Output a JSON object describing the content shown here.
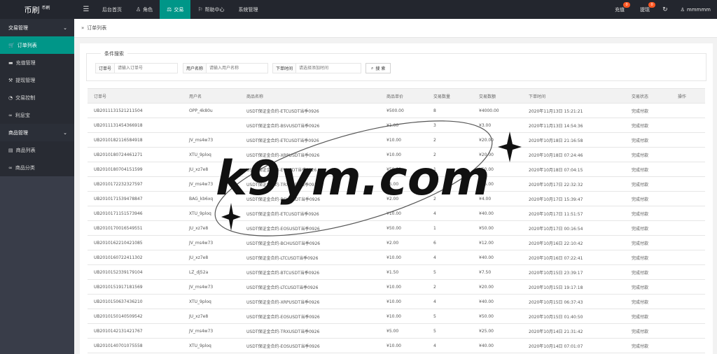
{
  "app": {
    "logo": "币刷",
    "logo_sub": "币刷"
  },
  "topnav": {
    "menu_icon": "hamburger-icon",
    "items": [
      {
        "label": "后台首页",
        "icon": ""
      },
      {
        "label": "角色",
        "icon": "user-icon"
      },
      {
        "label": "交易",
        "icon": "exchange-icon",
        "active": true
      },
      {
        "label": "帮助中心",
        "icon": "flag-icon"
      },
      {
        "label": "系统管理",
        "icon": ""
      }
    ],
    "recharge": "充值",
    "recharge_badge": "0",
    "withdraw": "提现",
    "withdraw_badge": "0",
    "username": "mmmmm"
  },
  "sidebar": {
    "groups": [
      {
        "title": "交易管理",
        "items": [
          "订单列表",
          "充值管理",
          "提现管理",
          "交易控制",
          "利息宝"
        ]
      },
      {
        "title": "商品管理",
        "items": [
          "商品列表",
          "商品分类"
        ]
      }
    ]
  },
  "breadcrumb": "订单列表",
  "search": {
    "legend": "条件搜索",
    "order_label": "订单号",
    "order_placeholder": "请输入订单号",
    "user_label": "用户名称",
    "user_placeholder": "请输入用户名称",
    "time_label": "下单时间",
    "time_placeholder": "请选择添加时间",
    "button": "搜 索"
  },
  "table": {
    "headers": [
      "订单号",
      "用户名",
      "商品名称",
      "商品单价",
      "交易数量",
      "交易数额",
      "下单时间",
      "交易状态",
      "操作"
    ],
    "rows": [
      [
        "UB2011131521211504",
        "OPP_4k80u",
        "USDT保证金合约-ETCUSDT当季0926",
        "¥500.00",
        "8",
        "¥4000.00",
        "2020年11月13日 15:21:21",
        "完成付款",
        ""
      ],
      [
        "UB2011131454366918",
        "",
        "USDT保证金合约-BSVUSDT当季0926",
        "¥1.00",
        "3",
        "¥3.00",
        "2020年11月13日 14:54:36",
        "完成付款",
        ""
      ],
      [
        "UB2010182116584918",
        "JV_ms4w73",
        "USDT保证金合约-ETCUSDT当季0926",
        "¥10.00",
        "2",
        "¥20.00",
        "2020年10月18日 21:16:58",
        "完成付款",
        ""
      ],
      [
        "UB2010180724461271",
        "XTU_9ploq",
        "USDT保证金合约-XRPUSDT当季0926",
        "¥10.00",
        "2",
        "¥20.00",
        "2020年10月18日 07:24:46",
        "完成付款",
        ""
      ],
      [
        "UB2010180704151599",
        "JU_xz7e8",
        "USDT保证金合约-EVUSDT当季0926",
        "¥50.00",
        "1",
        "¥50.00",
        "2020年10月18日 07:04:15",
        "完成付款",
        ""
      ],
      [
        "UB2010172232327597",
        "JV_ms4w73",
        "USDT保证金合约-TRXUSDT当季0926",
        "¥5.00",
        "5",
        "¥25.00",
        "2020年10月17日 22:32:32",
        "完成付款",
        ""
      ],
      [
        "UB2010171539478847",
        "BAG_kb6xq",
        "USDT保证金合约-BCHUSDT当季0926",
        "¥2.00",
        "2",
        "¥4.00",
        "2020年10月17日 15:39:47",
        "完成付款",
        ""
      ],
      [
        "UB2010171151573946",
        "XTU_9ploq",
        "USDT保证金合约-ETCUSDT当季0926",
        "¥10.00",
        "4",
        "¥40.00",
        "2020年10月17日 11:51:57",
        "完成付款",
        ""
      ],
      [
        "UB2010170016549551",
        "JU_xz7e8",
        "USDT保证金合约-EOSUSDT当季0926",
        "¥50.00",
        "1",
        "¥50.00",
        "2020年10月17日 00:16:54",
        "完成付款",
        ""
      ],
      [
        "UB2010162210421085",
        "JV_ms4w73",
        "USDT保证金合约-BCHUSDT当季0926",
        "¥2.00",
        "6",
        "¥12.00",
        "2020年10月16日 22:10:42",
        "完成付款",
        ""
      ],
      [
        "UB2010160722411302",
        "JU_xz7e8",
        "USDT保证金合约-LTCUSDT当季0926",
        "¥10.00",
        "4",
        "¥40.00",
        "2020年10月16日 07:22:41",
        "完成付款",
        ""
      ],
      [
        "UB2010152339179104",
        "LZ_dj52a",
        "USDT保证金合约-BTCUSDT当季0926",
        "¥1.50",
        "5",
        "¥7.50",
        "2020年10月15日 23:39:17",
        "完成付款",
        ""
      ],
      [
        "UB2010151917181569",
        "JV_ms4w73",
        "USDT保证金合约-LTCUSDT当季0926",
        "¥10.00",
        "2",
        "¥20.00",
        "2020年10月15日 19:17:18",
        "完成付款",
        ""
      ],
      [
        "UB2010150637436210",
        "XTU_9ploq",
        "USDT保证金合约-XRPUSDT当季0926",
        "¥10.00",
        "4",
        "¥40.00",
        "2020年10月15日 06:37:43",
        "完成付款",
        ""
      ],
      [
        "UB2010150140509542",
        "JU_xz7e8",
        "USDT保证金合约-EOSUSDT当季0926",
        "¥10.00",
        "5",
        "¥50.00",
        "2020年10月15日 01:40:50",
        "完成付款",
        ""
      ],
      [
        "UB2010142131421767",
        "JV_ms4w73",
        "USDT保证金合约-TRXUSDT当季0926",
        "¥5.00",
        "5",
        "¥25.00",
        "2020年10月14日 21:31:42",
        "完成付款",
        ""
      ],
      [
        "UB2010140701075558",
        "XTU_9ploq",
        "USDT保证金合约-EOSUSDT当季0926",
        "¥10.00",
        "4",
        "¥40.00",
        "2020年10月14日 07:01:07",
        "完成付款",
        ""
      ]
    ]
  },
  "watermark": {
    "text": "k9ym.com"
  }
}
